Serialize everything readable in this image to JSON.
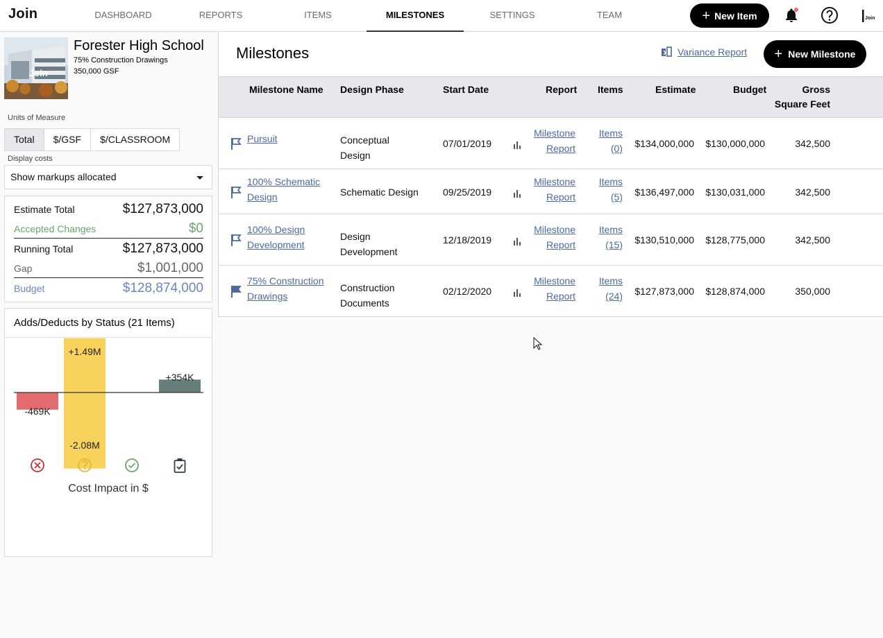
{
  "nav": {
    "logo": "Join",
    "tabs": [
      {
        "label": "DASHBOARD",
        "active": false
      },
      {
        "label": "REPORTS",
        "active": false
      },
      {
        "label": "ITEMS",
        "active": false
      },
      {
        "label": "MILESTONES",
        "active": true
      },
      {
        "label": "SETTINGS",
        "active": false
      },
      {
        "label": "TEAM",
        "active": false
      }
    ],
    "new_item_label": "New Item",
    "icons": [
      "bell-icon",
      "help-icon",
      "user-avatar"
    ],
    "avatar_label": "Join"
  },
  "project": {
    "name": "Forester High School",
    "milestone": "75% Construction Drawings",
    "gsf": "350,000 GSF",
    "image_logo": "Join"
  },
  "units": {
    "label": "Units of Measure",
    "options": [
      "Total",
      "$/GSF",
      "$/CLASSROOM"
    ],
    "selected": "Total"
  },
  "display_costs": {
    "label": "Display costs",
    "value": "Show markups allocated"
  },
  "totals": [
    {
      "label": "Estimate Total",
      "value": "$127,873,000",
      "color": "#222222"
    },
    {
      "label": "Accepted Changes",
      "value": "$0",
      "color": "#6aa56f"
    },
    {
      "label": "Running Total",
      "value": "$127,873,000",
      "color": "#222222"
    },
    {
      "label": "Gap",
      "value": "$1,001,000",
      "color": "#666666"
    },
    {
      "label": "Budget",
      "value": "$128,874,000",
      "color": "#6a85bd"
    }
  ],
  "adds_deducts": {
    "title": "Adds/Deducts by Status (21 Items)",
    "footer": "Cost Impact in $",
    "status_icons": [
      "rejected-icon",
      "pending-icon",
      "accepted-icon",
      "incorporated-icon"
    ]
  },
  "chart_data": {
    "type": "bar",
    "title": "Adds/Deducts by Status (21 Items)",
    "xlabel": "Cost Impact in $",
    "categories": [
      "Rejected",
      "Pending",
      "Accepted",
      "Incorporated"
    ],
    "colors": [
      "#e26b6f",
      "#f7d25c",
      "#6aa56f",
      "#687e7c"
    ],
    "adds": [
      0,
      1490000,
      0,
      354000
    ],
    "deducts": [
      469000,
      2080000,
      0,
      0
    ],
    "labels": [
      {
        "category": "Rejected",
        "text": "-469K"
      },
      {
        "category": "Pending",
        "text": "+1.49M"
      },
      {
        "category": "Pending",
        "text": "-2.08M"
      },
      {
        "category": "Incorporated",
        "text": "+354K"
      }
    ]
  },
  "main": {
    "title": "Milestones",
    "variance_label": "Variance Report",
    "new_milestone_label": "New Milestone",
    "columns": [
      "Milestone Name",
      "Design Phase",
      "Start Date",
      "Report",
      "Items",
      "Estimate",
      "Budget",
      "Gross Square Feet"
    ],
    "rows": [
      {
        "name": [
          "Pursuit"
        ],
        "phase": [
          "Conceptual",
          "Design"
        ],
        "start": "07/01/2019",
        "report": [
          "Milestone",
          "Report"
        ],
        "items": [
          "Items",
          "(0)"
        ],
        "estimate": "$134,000,000",
        "budget": "$130,000,000",
        "gsf": "342,500",
        "active": false
      },
      {
        "name": [
          "100% Schematic",
          "Design"
        ],
        "phase": [
          "Schematic Design"
        ],
        "start": "09/25/2019",
        "report": [
          "Milestone",
          "Report"
        ],
        "items": [
          "Items",
          "(5)"
        ],
        "estimate": "$136,497,000",
        "budget": "$130,031,000",
        "gsf": "342,500",
        "active": false
      },
      {
        "name": [
          "100% Design",
          "Development"
        ],
        "phase": [
          "Design",
          "Development"
        ],
        "start": "12/18/2019",
        "report": [
          "Milestone",
          "Report"
        ],
        "items": [
          "Items",
          "(15)"
        ],
        "estimate": "$130,510,000",
        "budget": "$128,775,000",
        "gsf": "342,500",
        "active": false
      },
      {
        "name": [
          "75% Construction",
          "Drawings"
        ],
        "phase": [
          "Construction",
          "Documents"
        ],
        "start": "02/12/2020",
        "report": [
          "Milestone",
          "Report"
        ],
        "items": [
          "Items",
          "(24)"
        ],
        "estimate": "$127,873,000",
        "budget": "$128,874,000",
        "gsf": "350,000",
        "active": true
      }
    ]
  }
}
